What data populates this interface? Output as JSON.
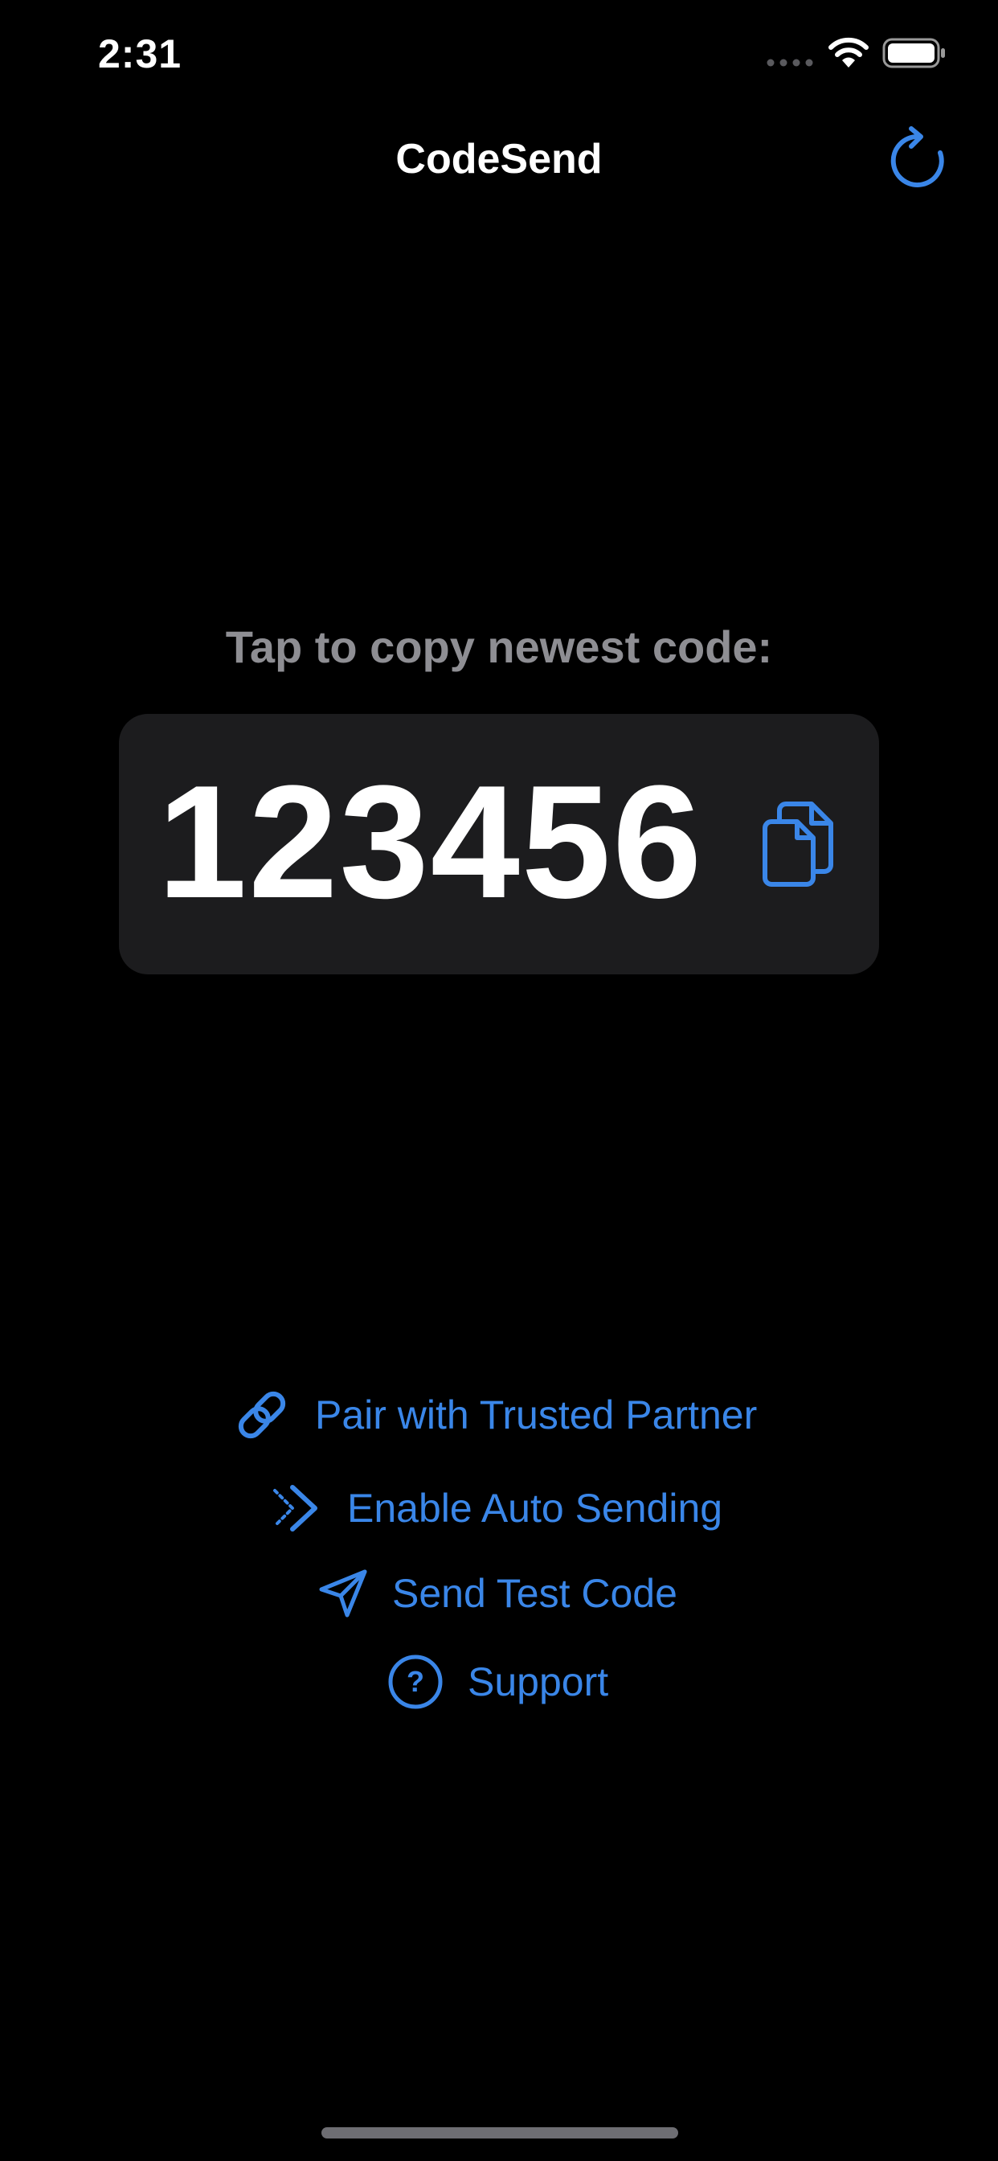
{
  "status_bar": {
    "time": "2:31",
    "icons": [
      "signal-icon",
      "wifi-icon",
      "battery-icon"
    ]
  },
  "nav": {
    "title": "CodeSend",
    "refresh_icon": "refresh-icon"
  },
  "main": {
    "prompt": "Tap to copy newest code:",
    "code": "123456",
    "copy_icon": "copy-icon"
  },
  "actions": [
    {
      "label": "Pair with Trusted Partner",
      "icon": "link-icon"
    },
    {
      "label": "Enable Auto Sending",
      "icon": "chevron-forward-icon"
    },
    {
      "label": "Send Test Code",
      "icon": "paper-plane-icon"
    },
    {
      "label": "Support",
      "icon": "question-circle-icon"
    }
  ],
  "colors": {
    "background": "#000000",
    "accent": "#3a86e8",
    "card": "#1c1c1e",
    "secondary_text": "#8e8e93"
  }
}
